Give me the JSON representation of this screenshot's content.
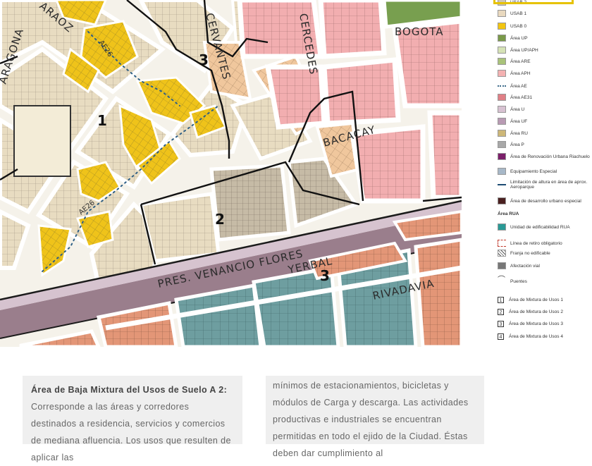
{
  "map": {
    "street_labels": [
      "ARAOZ",
      "BACACAY",
      "BOGOTA",
      "RIVADAVIA",
      "YERBAL",
      "PRES. VENANCIO FLORES",
      "CERVANTES",
      "CERCEDES",
      "ARAGONA"
    ],
    "ae_labels": [
      "AE26",
      "AE26"
    ],
    "zone_numbers": [
      "1",
      "2",
      "3",
      "3"
    ]
  },
  "legend": {
    "top_highlight": "USAB 2",
    "items": [
      {
        "label": "USAB 1",
        "color": "#e9d9bf",
        "kind": "swatch"
      },
      {
        "label": "USAB 0",
        "color": "#f2c511",
        "kind": "swatch"
      },
      {
        "label": "Área UP",
        "color": "#7a9a49",
        "kind": "swatch"
      },
      {
        "label": "Área UP/APH",
        "color": "#d6e3b6",
        "kind": "swatch"
      },
      {
        "label": "Área ARE",
        "color": "#a9c37a",
        "kind": "swatch"
      },
      {
        "label": "Área APH",
        "color": "#f4b2b2",
        "kind": "swatch"
      },
      {
        "label": "Área AE",
        "color": "#3f6d8c",
        "kind": "dots"
      },
      {
        "label": "Área AE31",
        "color": "#e07f86",
        "kind": "swatch"
      },
      {
        "label": "Área U",
        "color": "#d8c2d2",
        "kind": "swatch"
      },
      {
        "label": "Área UF",
        "color": "#b89ab3",
        "kind": "swatch"
      },
      {
        "label": "Área RU",
        "color": "#cdb778",
        "kind": "swatch"
      },
      {
        "label": "Área P",
        "color": "#a8a8a8",
        "kind": "swatch"
      },
      {
        "label": "Área de Renovación Urbana Riachuelo",
        "color": "#7b1f6a",
        "kind": "swatch"
      },
      {
        "label": "Equipamiento Especial",
        "color": "#a7b8c8",
        "kind": "swatch"
      },
      {
        "label": "Limitación de altura en área de aprox. Aeroparque",
        "color": "#1d4b73",
        "kind": "line"
      },
      {
        "label": "Área de desarrollo urbano especial",
        "color": "#4a2020",
        "kind": "swatch"
      },
      {
        "label": "Área RUA",
        "kind": "heading"
      },
      {
        "label": "Unidad de edificabilidad RUA",
        "color": "#2a9a96",
        "kind": "swatch"
      },
      {
        "label": "Línea de retiro obligatorio",
        "color": "#c0392b",
        "kind": "bracket"
      },
      {
        "label": "Franja no edificable",
        "color": "#555555",
        "kind": "hatch"
      },
      {
        "label": "Afectación vial",
        "color": "#777777",
        "kind": "swatch"
      },
      {
        "label": "Puentes",
        "color": "#444444",
        "kind": "bridge"
      },
      {
        "label": "Área de Mixtura de Usos 1",
        "num": "1",
        "kind": "num"
      },
      {
        "label": "Área de Mixtura de Usos 2",
        "num": "2",
        "kind": "num"
      },
      {
        "label": "Área de Mixtura de Usos 3",
        "num": "3",
        "kind": "num"
      },
      {
        "label": "Área de Mixtura de Usos 4",
        "num": "4",
        "kind": "num"
      }
    ]
  },
  "cards": {
    "left": {
      "title": "Área de Baja Mixtura del Usos de Suelo A 2:",
      "body": "Corresponde a las áreas y corredores destinados a residencia, servicios y comercios de mediana afluencia. Los usos que resulten de aplicar las"
    },
    "right": {
      "body": "mínimos de estacionamientos, bicicletas y módulos de Carga y descarga. Las actividades productivas e industriales se encuentran permitidas en todo el ejido de la Ciudad. Éstas deben dar cumplimiento al"
    }
  }
}
